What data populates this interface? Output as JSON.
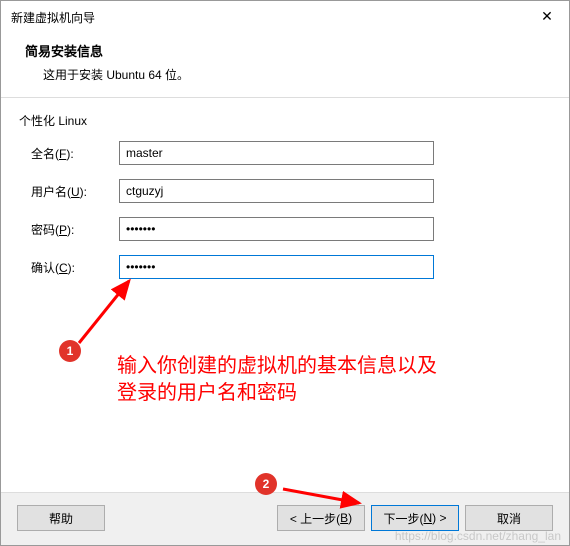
{
  "titlebar": {
    "title": "新建虚拟机向导",
    "close": "✕"
  },
  "header": {
    "h1": "简易安装信息",
    "h2": "这用于安装 Ubuntu 64 位。"
  },
  "section_label": "个性化 Linux",
  "form": {
    "fullname": {
      "label_pre": "全名(",
      "label_key": "F",
      "label_post": "):",
      "value": "master"
    },
    "username": {
      "label_pre": "用户名(",
      "label_key": "U",
      "label_post": "):",
      "value": "ctguzyj"
    },
    "password": {
      "label_pre": "密码(",
      "label_key": "P",
      "label_post": "):",
      "value": "1234567"
    },
    "confirm": {
      "label_pre": "确认(",
      "label_key": "C",
      "label_post": "):",
      "value": "1234567"
    }
  },
  "buttons": {
    "help": "帮助",
    "back_pre": "< 上一步(",
    "back_key": "B",
    "back_post": ")",
    "next_pre": "下一步(",
    "next_key": "N",
    "next_post": ") >",
    "cancel": "取消"
  },
  "annotation": {
    "badge1": "1",
    "badge2": "2",
    "line1": "输入你创建的虚拟机的基本信息以及",
    "line2": "登录的用户名和密码"
  },
  "watermark": "https://blog.csdn.net/zhang_lan"
}
